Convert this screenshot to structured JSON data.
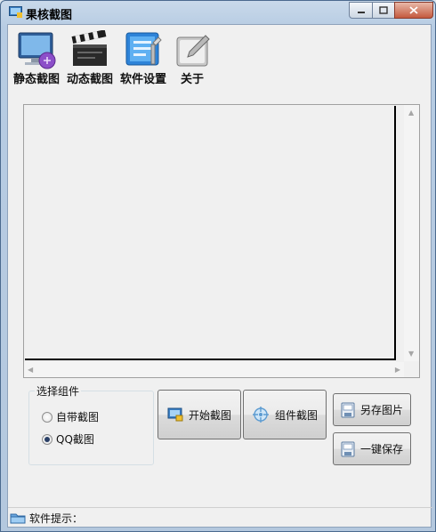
{
  "window": {
    "title": "果核截图",
    "icons": {
      "app": "app-icon",
      "minimize": "minimize-icon",
      "maximize": "maximize-icon",
      "close": "close-icon"
    }
  },
  "toolbar": {
    "items": [
      {
        "label": "静态截图",
        "icon": "monitor-icon"
      },
      {
        "label": "动态截图",
        "icon": "clapperboard-icon"
      },
      {
        "label": "软件设置",
        "icon": "settings-icon"
      },
      {
        "label": "关于",
        "icon": "about-icon"
      }
    ]
  },
  "component_group": {
    "title": "选择组件",
    "options": [
      {
        "label": "自带截图",
        "checked": false
      },
      {
        "label": "QQ截图",
        "checked": true
      }
    ]
  },
  "buttons": {
    "start_capture": "开始截图",
    "component_capture": "组件截图",
    "save_as": "另存图片",
    "one_click_save": "一键保存"
  },
  "status": {
    "label": "软件提示：",
    "icon": "folder-icon"
  },
  "colors": {
    "title_bar": "#b7cce3",
    "client_bg": "#f0f0f0",
    "close_button": "#c45a3e"
  }
}
